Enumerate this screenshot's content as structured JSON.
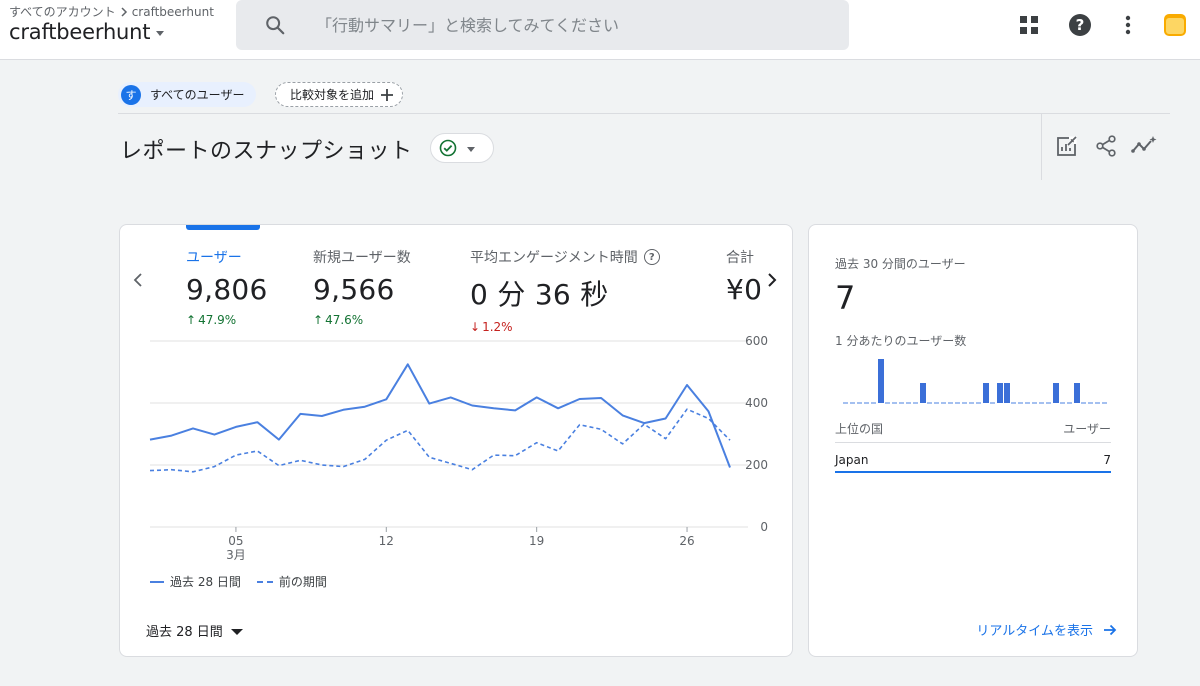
{
  "header": {
    "breadcrumb_root": "すべてのアカウント",
    "breadcrumb_child": "craftbeerhunt",
    "account_name": "craftbeerhunt",
    "search_placeholder": "「行動サマリー」と検索してみてください"
  },
  "filters": {
    "segment_badge": "す",
    "segment_label": "すべてのユーザー",
    "add_comparison": "比較対象を追加"
  },
  "report": {
    "title": "レポートのスナップショット"
  },
  "metrics": [
    {
      "label": "ユーザー",
      "value": "9,806",
      "delta": "47.9%",
      "direction": "up"
    },
    {
      "label": "新規ユーザー数",
      "value": "9,566",
      "delta": "47.6%",
      "direction": "up"
    },
    {
      "label": "平均エンゲージメント時間",
      "value": "0 分 36 秒",
      "delta": "1.2%",
      "direction": "down"
    },
    {
      "label": "合計",
      "value": "¥0",
      "delta": "",
      "direction": ""
    }
  ],
  "chart_data": {
    "type": "line",
    "x_tick_labels": [
      "05",
      "12",
      "19",
      "26"
    ],
    "x_tick_sublabels": [
      "3月",
      "",
      "",
      ""
    ],
    "y_tick_labels": [
      "600",
      "400",
      "200",
      "0"
    ],
    "ylim": [
      0,
      600
    ],
    "series": [
      {
        "name": "過去 28 日間",
        "style": "solid",
        "color": "#4a80e0",
        "values": [
          282,
          295,
          318,
          298,
          323,
          338,
          282,
          365,
          358,
          378,
          388,
          412,
          525,
          398,
          418,
          392,
          383,
          376,
          418,
          383,
          413,
          416,
          360,
          335,
          350,
          458,
          373,
          192
        ]
      },
      {
        "name": "前の期間",
        "style": "dashed",
        "color": "#4a80e0",
        "values": [
          182,
          185,
          178,
          195,
          232,
          245,
          198,
          215,
          200,
          195,
          218,
          280,
          312,
          225,
          205,
          185,
          232,
          230,
          272,
          245,
          330,
          315,
          268,
          332,
          285,
          380,
          350,
          280
        ]
      }
    ]
  },
  "legend": {
    "current": "過去 28 日間",
    "previous": "前の期間"
  },
  "date_range_label": "過去 28 日間",
  "realtime": {
    "title": "過去 30 分間のユーザー",
    "value": "7",
    "per_minute_label": "1 分あたりのユーザー数",
    "per_minute": [
      0,
      0,
      0,
      0,
      0,
      1,
      0,
      0,
      0,
      0,
      0,
      1,
      0,
      0,
      0,
      0,
      0,
      0,
      0,
      0,
      1,
      0,
      1,
      1,
      0,
      0,
      0,
      0,
      0,
      0,
      1,
      0,
      0,
      1,
      0,
      0,
      0,
      0
    ],
    "country_header": "上位の国",
    "users_header": "ユーザー",
    "country": "Japan",
    "country_users": "7",
    "link_label": "リアルタイムを表示"
  }
}
